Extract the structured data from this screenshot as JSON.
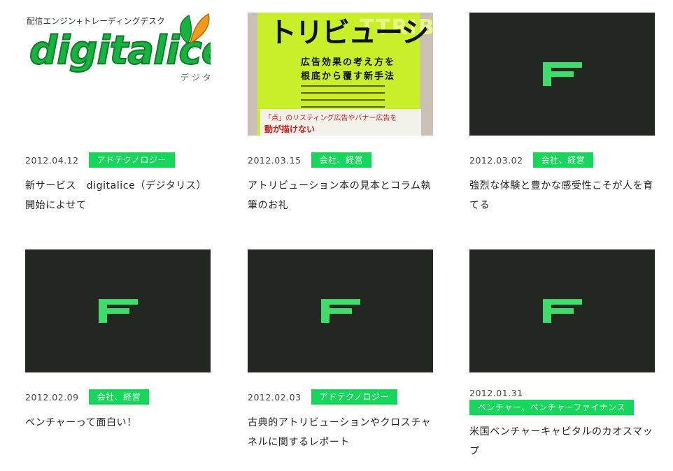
{
  "posts": [
    {
      "date": "2012.04.12",
      "category": "アドテクノロジー",
      "title": "新サービス　digitalice（デジタリス）開始によせて",
      "thumbnail": {
        "type": "logo",
        "subtitle": "配信エンジン+トレーディングデスク",
        "wordmark": "digitalice",
        "kana": "デジタ"
      }
    },
    {
      "date": "2012.03.15",
      "category": "会社、経営",
      "title": "アトリビューション本の見本とコラム執筆のお礼",
      "thumbnail": {
        "type": "photo",
        "vertical_title": "トリビューシ",
        "subtitle_line1": "広告効果の考え方を",
        "subtitle_line2": "根底から覆す新手法",
        "ghost_text": "TTRIBUT",
        "band_line1": "「点」のリスティング広告やバナー広告を",
        "band_line2": "動が描けない"
      }
    },
    {
      "date": "2012.03.02",
      "category": "会社、経営",
      "title": "強烈な体験と豊かな感受性こそが人を育てる",
      "thumbnail": {
        "type": "placeholder"
      }
    },
    {
      "date": "2012.02.09",
      "category": "会社、経営",
      "title": "ベンチャーって面白い！",
      "thumbnail": {
        "type": "placeholder"
      }
    },
    {
      "date": "2012.02.03",
      "category": "アドテクノロジー",
      "title": "古典的アトリビューションやクロスチャネルに関するレポート",
      "thumbnail": {
        "type": "placeholder"
      }
    },
    {
      "date": "2012.01.31",
      "category": "ベンチャー、ベンチャーファイナンス",
      "title": "米国ベンチャーキャピタルのカオスマップ",
      "thumbnail": {
        "type": "placeholder"
      }
    }
  ],
  "colors": {
    "tag_bg": "#16d65b",
    "placeholder_bg": "#232722",
    "placeholder_logo": "#3ddc6b"
  },
  "icons": {
    "placeholder_logo": "f-logo-icon",
    "leaf": "leaf-icon"
  }
}
